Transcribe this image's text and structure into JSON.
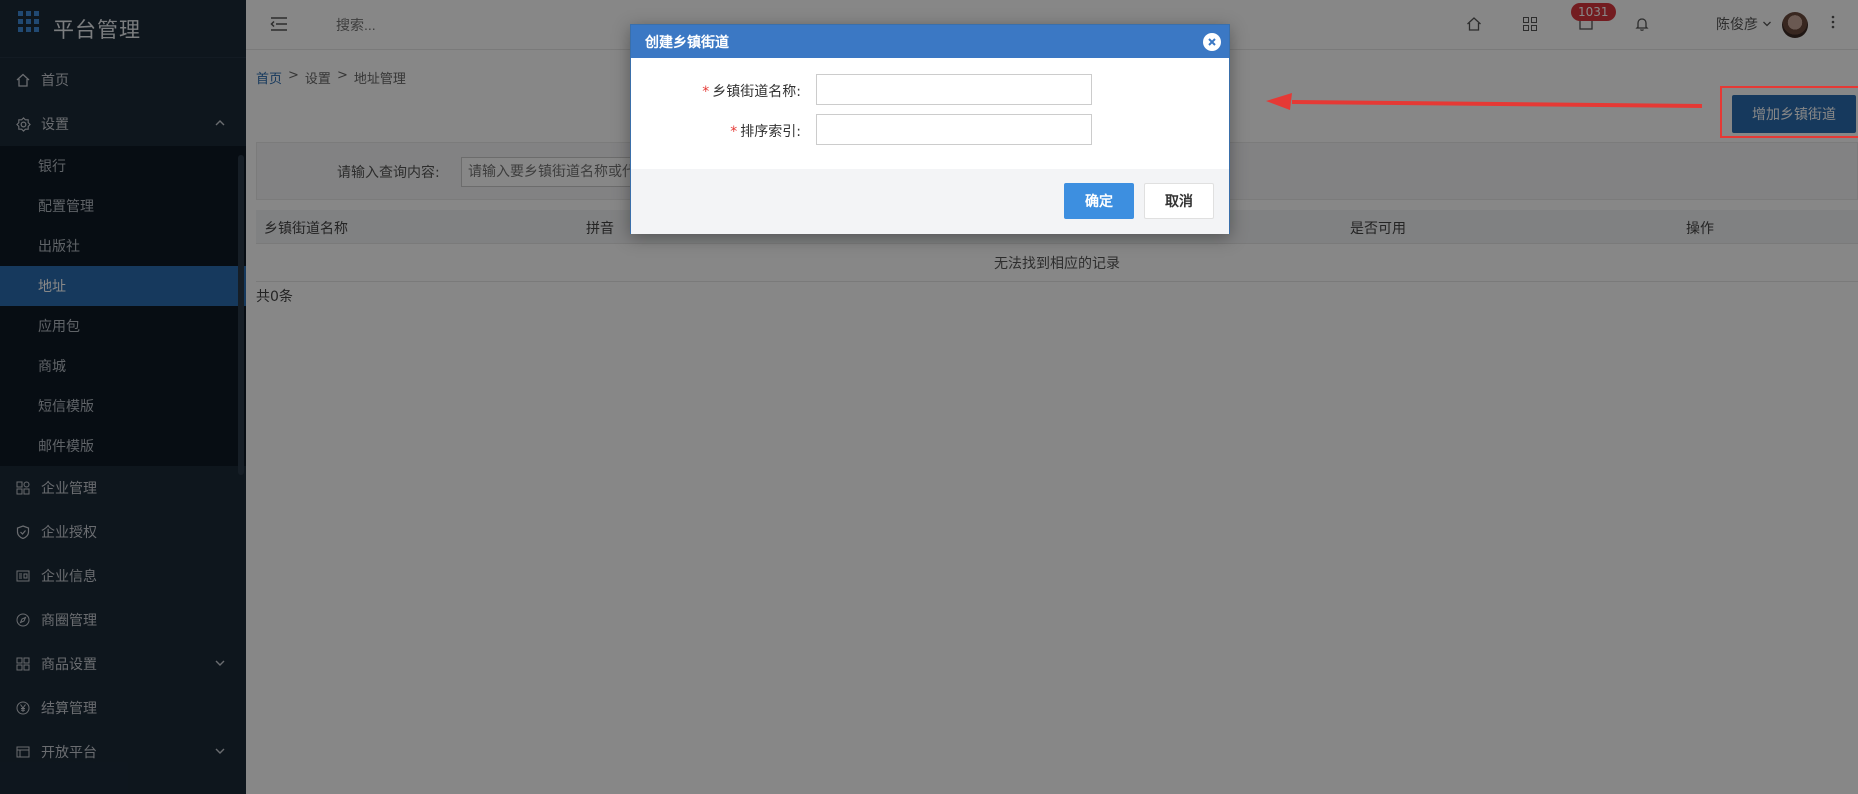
{
  "app": {
    "title": "平台管理"
  },
  "sidebar": {
    "items": [
      {
        "label": "首页",
        "icon": "home-icon"
      },
      {
        "label": "设置",
        "icon": "settings-icon",
        "expanded": true
      },
      {
        "label": "企业管理",
        "icon": "enterprise-icon"
      },
      {
        "label": "企业授权",
        "icon": "shield-check-icon"
      },
      {
        "label": "企业信息",
        "icon": "info-card-icon"
      },
      {
        "label": "商圈管理",
        "icon": "compass-icon"
      },
      {
        "label": "商品设置",
        "icon": "grid-icon"
      },
      {
        "label": "结算管理",
        "icon": "yen-icon"
      },
      {
        "label": "开放平台",
        "icon": "platform-icon"
      }
    ],
    "settings_sub": [
      "银行",
      "配置管理",
      "出版社",
      "地址",
      "应用包",
      "商城",
      "短信模版",
      "邮件模版"
    ],
    "active_sub": "地址"
  },
  "topbar": {
    "search_placeholder": "搜索...",
    "badge_count": "1031",
    "user_name": "陈俊彦"
  },
  "breadcrumb": {
    "home": "首页",
    "sep": ">",
    "level1": "设置",
    "level2": "地址管理"
  },
  "toolbar": {
    "add_label": "增加乡镇街道"
  },
  "query": {
    "label": "请输入查询内容:",
    "placeholder": "请输入要乡镇街道名称或代"
  },
  "table": {
    "headers": [
      "乡镇街道名称",
      "拼音",
      "是否可用",
      "操作"
    ],
    "empty_text": "无法找到相应的记录",
    "count_text": "共0条"
  },
  "modal": {
    "title": "创建乡镇街道",
    "fields": [
      {
        "label": "乡镇街道名称:",
        "required_mark": "*",
        "value": ""
      },
      {
        "label": "排序索引:",
        "required_mark": "*",
        "value": ""
      }
    ],
    "ok_label": "确定",
    "cancel_label": "取消"
  },
  "colors": {
    "sidebar_bg": "#1b2a38",
    "active": "#2b6cb0",
    "modal_header": "#3b78c4",
    "annotation": "#e53935"
  }
}
